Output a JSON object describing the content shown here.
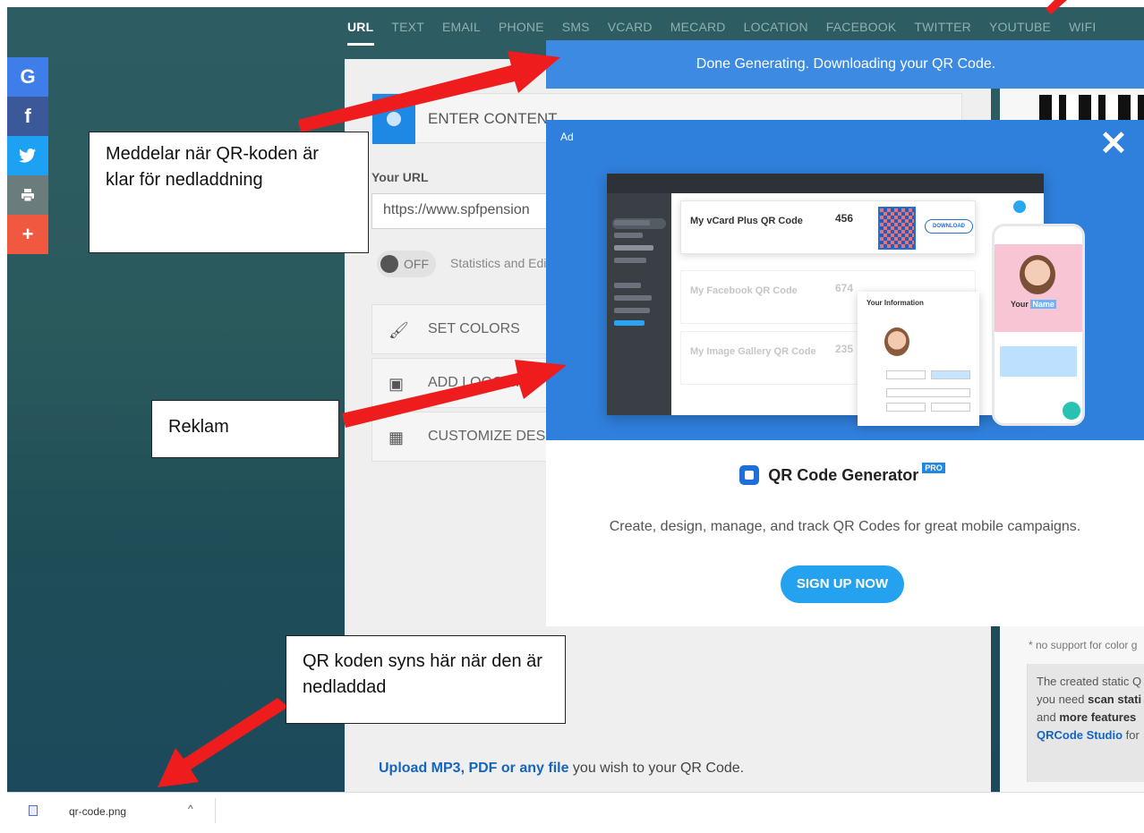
{
  "tabs": [
    "URL",
    "TEXT",
    "EMAIL",
    "PHONE",
    "SMS",
    "VCARD",
    "MECARD",
    "LOCATION",
    "FACEBOOK",
    "TWITTER",
    "YOUTUBE",
    "WIFI"
  ],
  "share": {
    "google": "G",
    "facebook": "f",
    "more": "+",
    "colors": {
      "google": "#3f7ee8",
      "facebook": "#3b5998",
      "twitter": "#1da1f2",
      "print": "#6b7c7c",
      "more": "#f0583f"
    }
  },
  "form": {
    "enter_content": "ENTER CONTENT",
    "url_label": "Your URL",
    "url_value": "https://www.spfpension",
    "toggle_state": "OFF",
    "stats_label": "Statistics and Edi",
    "set_colors": "SET COLORS",
    "add_logo": "ADD LOGO IM",
    "customize": "CUSTOMIZE DESI",
    "upload_link": "Upload MP3, PDF or any file",
    "upload_rest": " you wish to your QR Code."
  },
  "banner": {
    "text": "Done Generating. Downloading your QR Code."
  },
  "ad": {
    "label": "Ad",
    "close": "✕",
    "dashboard": {
      "card1_name": "My vCard Plus QR Code",
      "card1_num": "456",
      "download": "DOWNLOAD",
      "card2_name": "My Facebook QR Code",
      "card2_num": "674",
      "card3_name": "My Image Gallery QR Code",
      "card3_num": "235",
      "info_title": "Your Information",
      "phone_name_prefix": "Your ",
      "phone_name_highlight": "Name"
    },
    "brand_name": "QR Code Generator",
    "brand_badge": "PRO",
    "tagline": "Create, design, manage, and track QR Codes for great mobile campaigns.",
    "cta": "SIGN UP NOW"
  },
  "right_panel": {
    "no_support": "* no support for color g",
    "info_line1": "The created static Q",
    "info_line2_pre": "you need ",
    "info_line2_bold": "scan stati",
    "info_line3_pre": "and ",
    "info_line3_bold": "more features",
    "info_line4_link": "QRCode Studio",
    "info_line4_rest": " for"
  },
  "callouts": {
    "c1": "Meddelar när QR-koden är klar för nedladdning",
    "c2": "Reklam",
    "c3": "QR koden syns här när den är nedladdad"
  },
  "download_bar": {
    "file_name": "qr-code.png",
    "chevron": "^"
  },
  "arrow_color": "#ee1c1c"
}
